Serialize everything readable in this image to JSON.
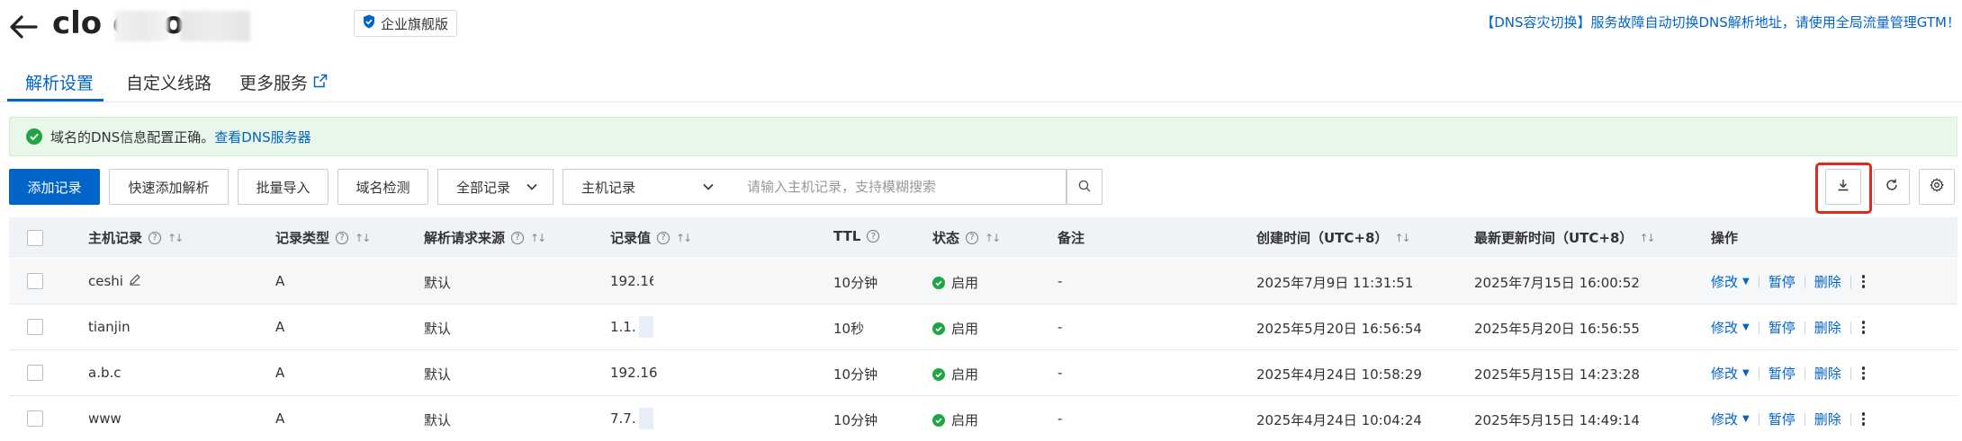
{
  "header": {
    "domain_title": "clo         e.com",
    "edition_badge": "企业旗舰版",
    "top_right_link": "【DNS容灾切换】服务故障自动切换DNS解析地址，请使用全局流量管理GTM！"
  },
  "tabs": [
    {
      "label": "解析设置"
    },
    {
      "label": "自定义线路"
    },
    {
      "label": "更多服务"
    }
  ],
  "alert": {
    "text": "域名的DNS信息配置正确。",
    "link": "查看DNS服务器"
  },
  "toolbar": {
    "add_record": "添加记录",
    "quick_add": "快速添加解析",
    "batch_import": "批量导入",
    "domain_check": "域名检测",
    "record_filter": "全部记录",
    "search_field": "主机记录",
    "search_placeholder": "请输入主机记录，支持模糊搜索"
  },
  "table": {
    "headers": {
      "host": "主机记录",
      "type": "记录类型",
      "line": "解析请求来源",
      "value": "记录值",
      "ttl": "TTL",
      "status": "状态",
      "remark": "备注",
      "created": "创建时间（UTC+8）",
      "updated": "最新更新时间（UTC+8）",
      "actions": "操作"
    },
    "rows": [
      {
        "host": "ceshi",
        "type": "A",
        "line": "默认",
        "value": "192.168",
        "ttl": "10分钟",
        "status": "启用",
        "remark": "-",
        "created": "2025年7月9日 11:31:51",
        "updated": "2025年7月15日 16:00:52"
      },
      {
        "host": "tianjin",
        "type": "A",
        "line": "默认",
        "value": "1.1.",
        "ttl": "10秒",
        "status": "启用",
        "remark": "-",
        "created": "2025年5月20日 16:56:54",
        "updated": "2025年5月20日 16:56:55"
      },
      {
        "host": "a.b.c",
        "type": "A",
        "line": "默认",
        "value": "192.16",
        "ttl": "10分钟",
        "status": "启用",
        "remark": "-",
        "created": "2025年4月24日 10:58:29",
        "updated": "2025年5月15日 14:23:28"
      },
      {
        "host": "www",
        "type": "A",
        "line": "默认",
        "value": "7.7.",
        "ttl": "10分钟",
        "status": "启用",
        "remark": "-",
        "created": "2025年4月24日 10:04:24",
        "updated": "2025年5月15日 14:49:14"
      }
    ],
    "row_actions": {
      "modify": "修改",
      "pause": "暂停",
      "delete": "删除"
    }
  },
  "colors": {
    "accent": "#0064c8",
    "success": "#1fa543",
    "alert_bg": "#e8f7ea",
    "highlight_box": "#e02a1d"
  },
  "icons": {
    "back": "back-arrow-icon",
    "shield": "shield-icon",
    "external": "external-link-icon",
    "check": "check-circle-icon",
    "search": "search-icon",
    "download": "download-icon",
    "refresh": "refresh-icon",
    "settings": "gear-icon"
  }
}
